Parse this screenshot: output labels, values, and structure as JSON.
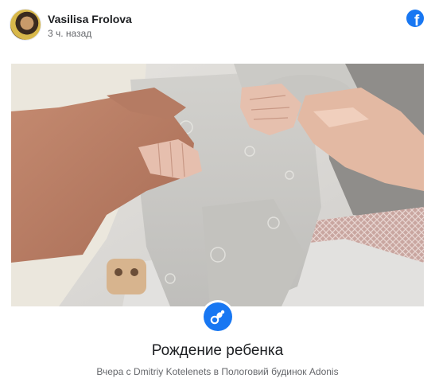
{
  "post": {
    "author": "Vasilisa Frolova",
    "timestamp": "3 ч. назад",
    "platform_icon": "facebook-logo-icon",
    "platform_glyph": "f"
  },
  "life_event": {
    "icon": "baby-pacifier-icon",
    "title": "Рождение ребенка",
    "subtitle": "Вчера с Dmitriy Kotelenets в Пологовий будинок Adonis"
  },
  "colors": {
    "brand": "#1877f2",
    "text_primary": "#1c1e21",
    "text_secondary": "#65676b"
  }
}
